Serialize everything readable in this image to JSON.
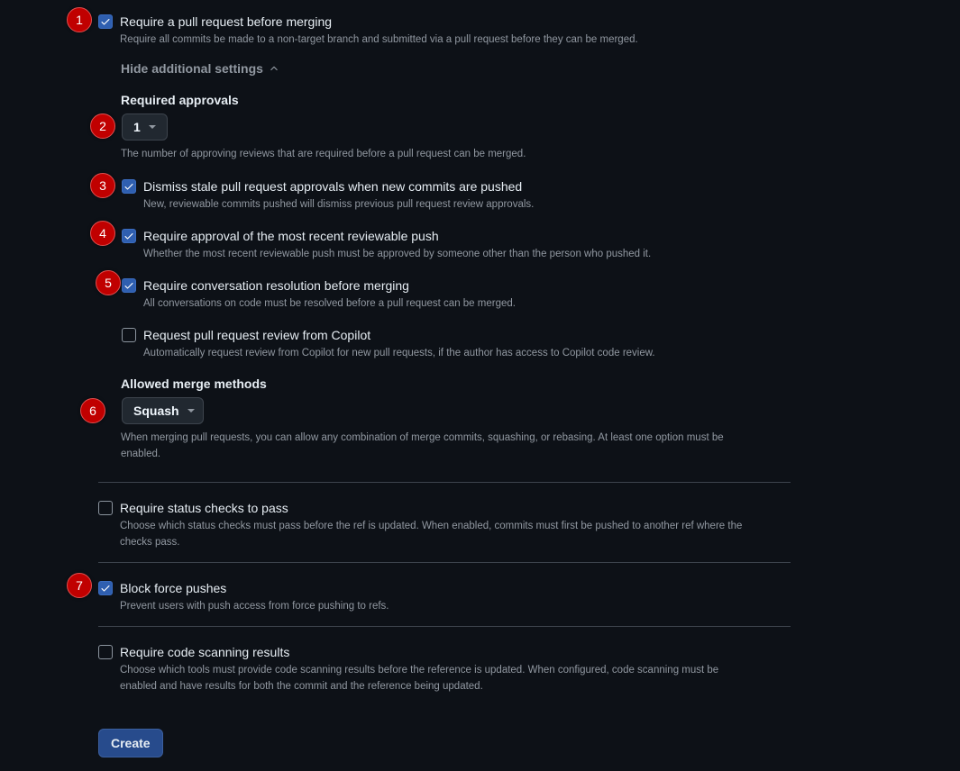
{
  "rules": {
    "require_pr": {
      "label": "Require a pull request before merging",
      "description": "Require all commits be made to a non-target branch and submitted via a pull request before they can be merged.",
      "checked": true
    },
    "hide_settings_label": "Hide additional settings",
    "required_approvals": {
      "heading": "Required approvals",
      "value": "1",
      "help": "The number of approving reviews that are required before a pull request can be merged."
    },
    "dismiss_stale": {
      "label": "Dismiss stale pull request approvals when new commits are pushed",
      "description": "New, reviewable commits pushed will dismiss previous pull request review approvals.",
      "checked": true
    },
    "recent_push": {
      "label": "Require approval of the most recent reviewable push",
      "description": "Whether the most recent reviewable push must be approved by someone other than the person who pushed it.",
      "checked": true
    },
    "conversation_resolution": {
      "label": "Require conversation resolution before merging",
      "description": "All conversations on code must be resolved before a pull request can be merged.",
      "checked": true
    },
    "copilot_review": {
      "label": "Request pull request review from Copilot",
      "description": "Automatically request review from Copilot for new pull requests, if the author has access to Copilot code review.",
      "checked": false
    },
    "merge_methods": {
      "heading": "Allowed merge methods",
      "value": "Squash",
      "help_line1": "When merging pull requests, you can allow any combination of merge commits, squashing, or rebasing. At least one option must be",
      "help_line2": "enabled."
    },
    "status_checks": {
      "label": "Require status checks to pass",
      "description_line1": "Choose which status checks must pass before the ref is updated. When enabled, commits must first be pushed to another ref where the",
      "description_line2": "checks pass.",
      "checked": false
    },
    "block_force_pushes": {
      "label": "Block force pushes",
      "description": "Prevent users with push access from force pushing to refs.",
      "checked": true
    },
    "code_scanning": {
      "label": "Require code scanning results",
      "description_line1": "Choose which tools must provide code scanning results before the reference is updated. When configured, code scanning must be",
      "description_line2": "enabled and have results for both the commit and the reference being updated.",
      "checked": false
    }
  },
  "annotations": [
    "1",
    "2",
    "3",
    "4",
    "5",
    "6",
    "7"
  ],
  "create_button": "Create",
  "colors": {
    "background": "#0d1117",
    "accent": "#2f5fb0",
    "badge": "#c00000",
    "muted_text": "#9198a1"
  },
  "icons": {
    "check": "check-icon",
    "chevron_up": "chevron-up-icon",
    "caret": "caret-down-icon"
  }
}
